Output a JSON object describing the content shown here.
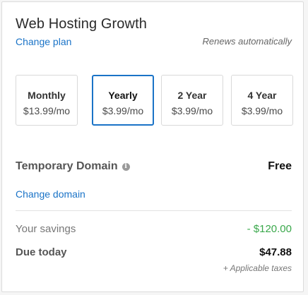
{
  "header": {
    "title": "Web Hosting Growth",
    "change_plan_label": "Change plan",
    "renews_text": "Renews automatically"
  },
  "plans": [
    {
      "name": "Monthly",
      "price": "$13.99/mo",
      "selected": false
    },
    {
      "name": "Yearly",
      "price": "$3.99/mo",
      "selected": true
    },
    {
      "name": "2 Year",
      "price": "$3.99/mo",
      "selected": false
    },
    {
      "name": "4 Year",
      "price": "$3.99/mo",
      "selected": false
    }
  ],
  "domain": {
    "label": "Temporary Domain",
    "info_icon": "info-icon",
    "value": "Free",
    "change_label": "Change domain"
  },
  "summary": {
    "savings_label": "Your savings",
    "savings_value": "- $120.00",
    "due_label": "Due today",
    "due_value": "$47.88",
    "taxes_note": "+ Applicable taxes"
  },
  "colors": {
    "accent": "#1a73c7",
    "savings": "#3aa84b"
  }
}
